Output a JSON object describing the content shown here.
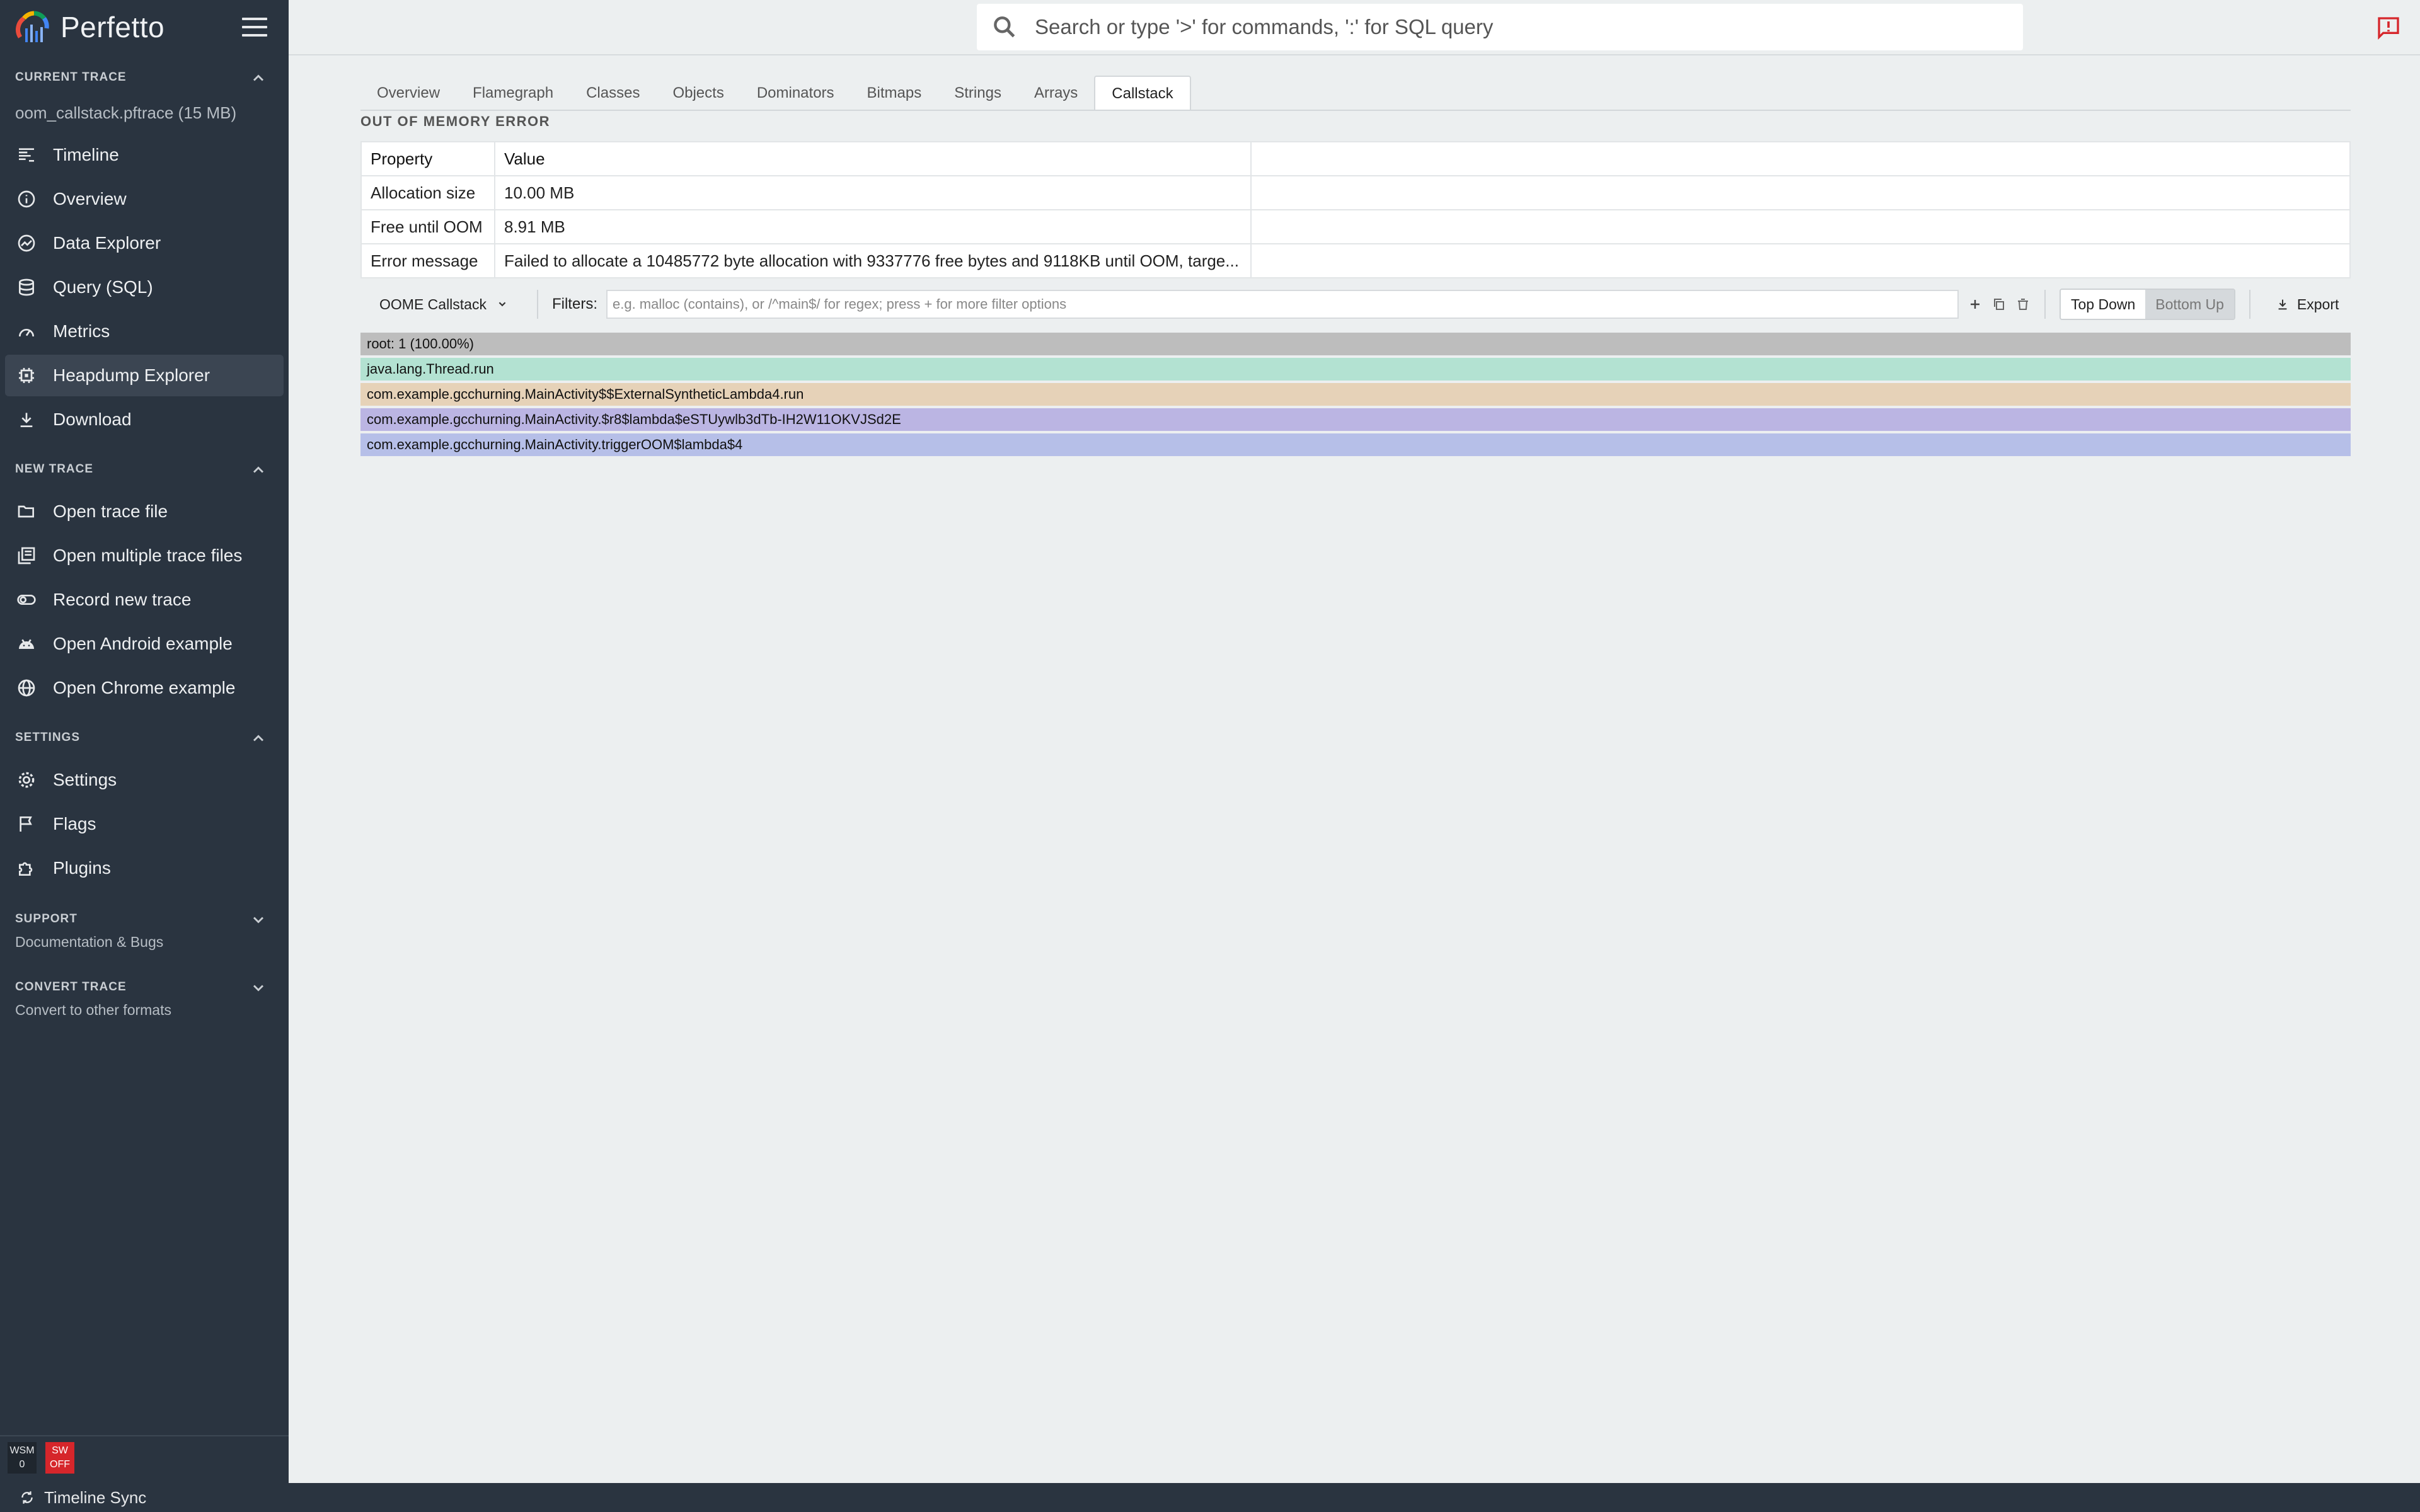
{
  "app": {
    "name": "Perfetto"
  },
  "sidebar": {
    "current_trace": {
      "title": "CURRENT TRACE",
      "file": "oom_callstack.pftrace (15 MB)",
      "items": [
        {
          "label": "Timeline",
          "icon": "timeline-icon"
        },
        {
          "label": "Overview",
          "icon": "info-icon"
        },
        {
          "label": "Data Explorer",
          "icon": "query-stats-icon"
        },
        {
          "label": "Query (SQL)",
          "icon": "database-icon"
        },
        {
          "label": "Metrics",
          "icon": "speed-icon"
        },
        {
          "label": "Heapdump Explorer",
          "icon": "memory-icon",
          "active": true
        },
        {
          "label": "Download",
          "icon": "download-icon"
        }
      ]
    },
    "new_trace": {
      "title": "NEW TRACE",
      "items": [
        {
          "label": "Open trace file",
          "icon": "folder-open-icon"
        },
        {
          "label": "Open multiple trace files",
          "icon": "library-books-icon"
        },
        {
          "label": "Record new trace",
          "icon": "record-icon"
        },
        {
          "label": "Open Android example",
          "icon": "android-icon"
        },
        {
          "label": "Open Chrome example",
          "icon": "language-icon"
        }
      ]
    },
    "settings": {
      "title": "SETTINGS",
      "items": [
        {
          "label": "Settings",
          "icon": "gear-icon"
        },
        {
          "label": "Flags",
          "icon": "flag-icon"
        },
        {
          "label": "Plugins",
          "icon": "extension-icon"
        }
      ]
    },
    "support": {
      "title": "SUPPORT",
      "subtitle": "Documentation & Bugs"
    },
    "convert_trace": {
      "title": "CONVERT TRACE",
      "subtitle": "Convert to other formats"
    },
    "wsm": {
      "label": "WSM",
      "value": "0"
    },
    "sw": {
      "line1": "SW",
      "line2": "OFF",
      "color": "#d6262b"
    }
  },
  "bottombar": {
    "label": "Timeline Sync"
  },
  "search": {
    "placeholder": "Search or type '>' for commands, ':' for SQL query"
  },
  "tabs": [
    "Overview",
    "Flamegraph",
    "Classes",
    "Objects",
    "Dominators",
    "Bitmaps",
    "Strings",
    "Arrays",
    "Callstack"
  ],
  "active_tab": "Callstack",
  "oom": {
    "title": "OUT OF MEMORY ERROR",
    "headers": [
      "Property",
      "Value"
    ],
    "rows": [
      {
        "property": "Allocation size",
        "value": "10.00 MB"
      },
      {
        "property": "Free until OOM",
        "value": "8.91 MB"
      },
      {
        "property": "Error message",
        "value": "Failed to allocate a 10485772 byte allocation with 9337776 free bytes and 9118KB until OOM, targe..."
      }
    ]
  },
  "toolbar": {
    "callstack_select": "OOME Callstack",
    "filters_label": "Filters:",
    "filter_placeholder": "e.g. malloc (contains), or /^main$/ for regex; press + for more filter options",
    "top_down": "Top Down",
    "bottom_up": "Bottom Up",
    "export": "Export"
  },
  "flame_rows": [
    {
      "label": "root: 1 (100.00%)",
      "color": "#bdbdbd"
    },
    {
      "label": "java.lang.Thread.run",
      "color": "#b3e2d2"
    },
    {
      "label": "com.example.gcchurning.MainActivity$$ExternalSyntheticLambda4.run",
      "color": "#e6d2b8"
    },
    {
      "label": "com.example.gcchurning.MainActivity.$r8$lambda$eSTUywlb3dTb-IH2W11OKVJSd2E",
      "color": "#bbb5e3"
    },
    {
      "label": "com.example.gcchurning.MainActivity.triggerOOM$lambda$4",
      "color": "#b6bfe8"
    }
  ],
  "colors": {
    "sidebar_bg": "#2a3440",
    "content_bg": "#eceff0",
    "feedback_red": "#d6262b"
  }
}
